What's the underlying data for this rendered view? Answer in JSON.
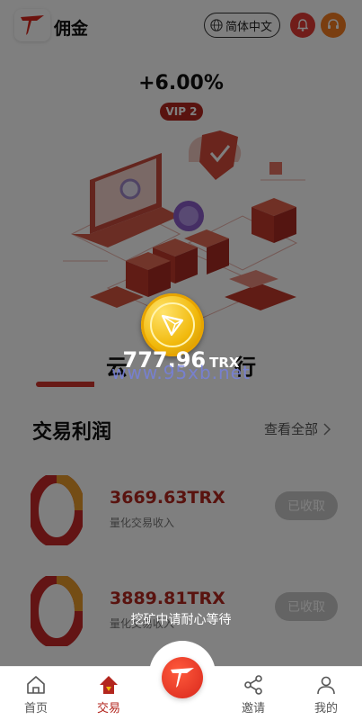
{
  "header": {
    "title": "佣金",
    "language_label": "简体中文"
  },
  "rate": {
    "value": "+6.00%",
    "vip_badge": "VIP 2"
  },
  "cloud": {
    "title": "云",
    "title_tail": "行",
    "mined_value": "777.96",
    "mined_unit": "TRX",
    "watermark": "www.95xb.net",
    "progress_fraction": 0.2
  },
  "section": {
    "title": "交易利润",
    "view_all": "查看全部"
  },
  "profits": [
    {
      "amount": "3669.63TRX",
      "label": "量化交易收入",
      "status": "已收取"
    },
    {
      "amount": "3889.81TRX",
      "label": "量化交易收入",
      "status": "已收取"
    }
  ],
  "toast": "挖矿中请耐心等待",
  "nav": {
    "items": [
      {
        "label": "首页",
        "icon": "home-icon"
      },
      {
        "label": "交易",
        "icon": "trade-icon"
      },
      {
        "label": "邀请",
        "icon": "share-icon"
      },
      {
        "label": "我的",
        "icon": "user-icon"
      }
    ],
    "active": "交易"
  },
  "colors": {
    "accent": "#b3261e",
    "bell": "#e23b34",
    "support": "#f57c20",
    "coin": "#f1b90c"
  }
}
